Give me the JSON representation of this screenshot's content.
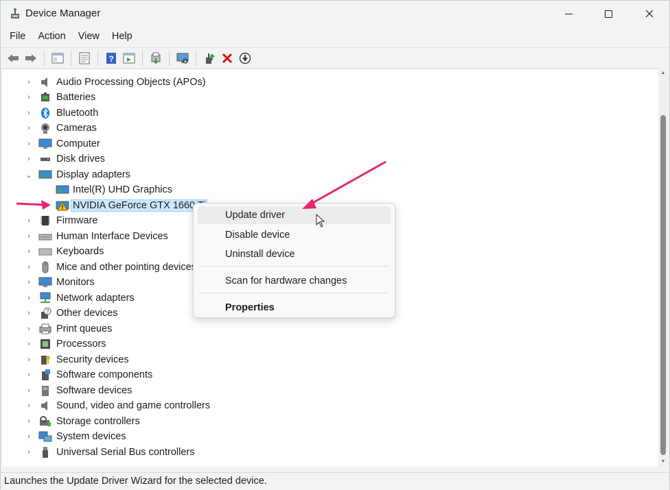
{
  "window": {
    "title": "Device Manager"
  },
  "menubar": {
    "items": [
      "File",
      "Action",
      "View",
      "Help"
    ]
  },
  "toolbar": {
    "buttons": [
      "back-icon",
      "forward-icon",
      "show-hide-console-tree-icon",
      "properties-icon",
      "help-icon",
      "export-list-icon",
      "print-icon",
      "scan-hardware-icon",
      "update-driver-icon",
      "uninstall-icon",
      "disable-icon"
    ]
  },
  "tree": {
    "items": [
      {
        "label": "Audio Processing Objects (APOs)",
        "expanded": false
      },
      {
        "label": "Batteries",
        "expanded": false
      },
      {
        "label": "Bluetooth",
        "expanded": false
      },
      {
        "label": "Cameras",
        "expanded": false
      },
      {
        "label": "Computer",
        "expanded": false
      },
      {
        "label": "Disk drives",
        "expanded": false
      },
      {
        "label": "Display adapters",
        "expanded": true
      },
      {
        "label": "Intel(R) UHD Graphics",
        "child": true
      },
      {
        "label": "NVIDIA GeForce GTX 1660 Ti",
        "child": true,
        "selected": true,
        "warning": true
      },
      {
        "label": "Firmware",
        "expanded": false
      },
      {
        "label": "Human Interface Devices",
        "expanded": false
      },
      {
        "label": "Keyboards",
        "expanded": false
      },
      {
        "label": "Mice and other pointing devices",
        "expanded": false
      },
      {
        "label": "Monitors",
        "expanded": false
      },
      {
        "label": "Network adapters",
        "expanded": false
      },
      {
        "label": "Other devices",
        "expanded": false
      },
      {
        "label": "Print queues",
        "expanded": false
      },
      {
        "label": "Processors",
        "expanded": false
      },
      {
        "label": "Security devices",
        "expanded": false
      },
      {
        "label": "Software components",
        "expanded": false
      },
      {
        "label": "Software devices",
        "expanded": false
      },
      {
        "label": "Sound, video and game controllers",
        "expanded": false
      },
      {
        "label": "Storage controllers",
        "expanded": false
      },
      {
        "label": "System devices",
        "expanded": false
      },
      {
        "label": "Universal Serial Bus controllers",
        "expanded": false
      }
    ]
  },
  "context_menu": {
    "items": [
      {
        "label": "Update driver",
        "hover": true
      },
      {
        "label": "Disable device"
      },
      {
        "label": "Uninstall device"
      },
      {
        "label": "Scan for hardware changes"
      },
      {
        "label": "Properties",
        "bold": true
      }
    ]
  },
  "statusbar": {
    "text": "Launches the Update Driver Wizard for the selected device."
  },
  "colors": {
    "accent": "#0067c0",
    "selection": "#cce8ff",
    "annotation_arrow": "#e8266e"
  }
}
